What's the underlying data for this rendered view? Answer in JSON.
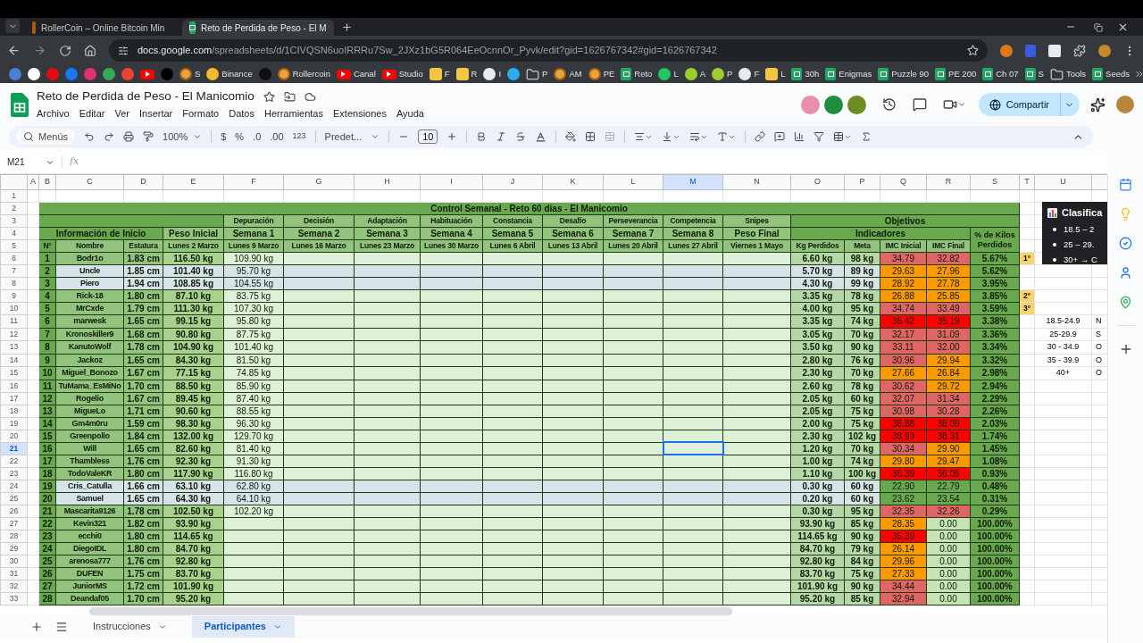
{
  "browser": {
    "tabs": [
      {
        "title": "RollerCoin – Online Bitcoin Min",
        "kind": "coin",
        "selected": false
      },
      {
        "title": "Reto de Perdida de Peso - El M",
        "kind": "sheet",
        "selected": true
      }
    ],
    "url_host": "docs.google.com",
    "url_path": "/spreadsheets/d/1CIVQSN6uoIRRRu7Sw_2JXz1bG5R064EeOcnnOr_Pyvk/edit?gid=1626767342#gid=1626767342",
    "bookmarks": [
      {
        "kind": "site",
        "color": "#4a7fd6"
      },
      {
        "kind": "site",
        "color": "#ffffff"
      },
      {
        "kind": "site",
        "color": "#e50914"
      },
      {
        "kind": "site",
        "color": "#1877f2"
      },
      {
        "kind": "site",
        "color": "#e1306c"
      },
      {
        "kind": "site",
        "color": "#34a853"
      },
      {
        "kind": "site",
        "color": "#ea4335"
      },
      {
        "kind": "video"
      },
      {
        "kind": "site",
        "color": "#000000"
      },
      {
        "kind": "coin",
        "label": "S"
      },
      {
        "kind": "site",
        "color": "#f3ba2f",
        "label": "Binance"
      },
      {
        "kind": "site",
        "color": "#111111"
      },
      {
        "kind": "coin",
        "label": "Rollercoin"
      },
      {
        "kind": "video",
        "label": "Canal"
      },
      {
        "kind": "video",
        "label": "Studio"
      },
      {
        "kind": "face",
        "label": "F"
      },
      {
        "kind": "face",
        "label": "R"
      },
      {
        "kind": "site",
        "color": "#e8eaed",
        "label": "I"
      },
      {
        "kind": "site",
        "color": "#2aabee"
      },
      {
        "kind": "folder",
        "label": "P"
      },
      {
        "kind": "coin",
        "label": "AM"
      },
      {
        "kind": "coin",
        "label": "PE"
      },
      {
        "kind": "sheet",
        "label": "Reto"
      },
      {
        "kind": "site",
        "color": "#22c55e",
        "label": "L"
      },
      {
        "kind": "site",
        "color": "#9acd32",
        "label": "A"
      },
      {
        "kind": "site",
        "color": "#9acd32",
        "label": "P"
      },
      {
        "kind": "site",
        "color": "#e8eaed",
        "label": "F"
      },
      {
        "kind": "face",
        "label": "L"
      },
      {
        "kind": "sheet",
        "label": "30h"
      },
      {
        "kind": "sheet",
        "label": "Enigmas"
      },
      {
        "kind": "sheet",
        "label": "Puzzle 90"
      },
      {
        "kind": "sheet",
        "label": "PE 200"
      },
      {
        "kind": "sheet",
        "label": "Ch 07"
      },
      {
        "kind": "sheet",
        "label": "S"
      },
      {
        "kind": "folder",
        "label": "Tools"
      },
      {
        "kind": "sheet",
        "label": "Seeds"
      }
    ]
  },
  "doc": {
    "title": "Reto de Perdida de Peso - El Manicomio",
    "menu": [
      "Archivo",
      "Editar",
      "Ver",
      "Insertar",
      "Formato",
      "Datos",
      "Herramientas",
      "Extensiones",
      "Ayuda"
    ],
    "share": "Compartir",
    "collaborators": [
      {
        "color": "#e88fb0"
      },
      {
        "color": "#1e8e3e"
      },
      {
        "color": "#6b8e23"
      }
    ]
  },
  "toolbar": {
    "search": "Menús",
    "zoom": "100%",
    "currency": "$",
    "percent": "%",
    "dec_less": ".0",
    "dec_more": ".00",
    "format_more": "123",
    "font": "Predet...",
    "font_size": "10"
  },
  "formula_bar": {
    "cell_ref": "M21",
    "fx": "fx"
  },
  "columns": [
    {
      "label": "A",
      "selected": false
    },
    {
      "label": "B",
      "selected": false
    },
    {
      "label": "C",
      "selected": false
    },
    {
      "label": "D",
      "selected": false
    },
    {
      "label": "E",
      "selected": false
    },
    {
      "label": "F",
      "selected": false
    },
    {
      "label": "G",
      "selected": false
    },
    {
      "label": "H",
      "selected": false
    },
    {
      "label": "I",
      "selected": false
    },
    {
      "label": "J",
      "selected": false
    },
    {
      "label": "K",
      "selected": false
    },
    {
      "label": "L",
      "selected": false
    },
    {
      "label": "M",
      "selected": true
    },
    {
      "label": "N",
      "selected": false
    },
    {
      "label": "O",
      "selected": false
    },
    {
      "label": "P",
      "selected": false
    },
    {
      "label": "Q",
      "selected": false
    },
    {
      "label": "R",
      "selected": false
    },
    {
      "label": "S",
      "selected": false
    },
    {
      "label": "T",
      "selected": false
    },
    {
      "label": "U",
      "selected": false
    }
  ],
  "row_headers": [
    {
      "label": "1",
      "selected": false
    },
    {
      "label": "2",
      "selected": false
    },
    {
      "label": "3",
      "selected": false
    },
    {
      "label": "4",
      "selected": false
    },
    {
      "label": "5",
      "selected": false
    },
    {
      "label": "6",
      "selected": false
    },
    {
      "label": "7",
      "selected": false
    },
    {
      "label": "8",
      "selected": false
    },
    {
      "label": "9",
      "selected": false
    },
    {
      "label": "10",
      "selected": false
    },
    {
      "label": "11",
      "selected": false
    },
    {
      "label": "12",
      "selected": false
    },
    {
      "label": "13",
      "selected": false
    },
    {
      "label": "14",
      "selected": false
    },
    {
      "label": "15",
      "selected": false
    },
    {
      "label": "16",
      "selected": false
    },
    {
      "label": "17",
      "selected": false
    },
    {
      "label": "18",
      "selected": false
    },
    {
      "label": "19",
      "selected": false
    },
    {
      "label": "20",
      "selected": false
    },
    {
      "label": "21",
      "selected": true
    },
    {
      "label": "22",
      "selected": false
    },
    {
      "label": "23",
      "selected": false
    },
    {
      "label": "24",
      "selected": false
    },
    {
      "label": "25",
      "selected": false
    },
    {
      "label": "26",
      "selected": false
    },
    {
      "label": "27",
      "selected": false
    },
    {
      "label": "28",
      "selected": false
    },
    {
      "label": "29",
      "selected": false
    },
    {
      "label": "30",
      "selected": false
    },
    {
      "label": "31",
      "selected": false
    },
    {
      "label": "32",
      "selected": false
    },
    {
      "label": "33",
      "selected": false
    }
  ],
  "sheet": {
    "title": "Control Semanal - Reto 60 días - El Manicomio",
    "phases": [
      "Depuración",
      "Decisión",
      "Adaptación",
      "Habituación",
      "Constancia",
      "Desafío",
      "Perseverancia",
      "Competencia",
      "Snipes"
    ],
    "objectives": "Objetivos",
    "info": "Información de Inicio",
    "initial_weight": "Peso Inicial",
    "weeks": [
      "Semana 1",
      "Semana 2",
      "Semana 3",
      "Semana 4",
      "Semana 5",
      "Semana 6",
      "Semana 7",
      "Semana 8",
      "Peso Final"
    ],
    "indicators": "Indicadores",
    "pct_header": "% de Kilos Perdidos",
    "headers": [
      "N°",
      "Nombre",
      "Estatura",
      "Lunes 2 Marzo",
      "Lunes 9 Marzo",
      "Lunes 16 Marzo",
      "Lunes 23 Marzo",
      "Lunes 30 Marzo",
      "Lunes 6 Abril",
      "Lunes 13 Abril",
      "Lunes 20 Abril",
      "Lunes 27 Abril",
      "Viernes 1 Mayo",
      "Kg Perdidos",
      "Meta",
      "IMC Inicial",
      "IMC Final"
    ],
    "rows": [
      {
        "n": "1",
        "name": "Bodr1o",
        "height": "1.83 cm",
        "initial": "116.50 kg",
        "week1": "109.90 kg",
        "lost": "6.60 kg",
        "goal": "98 kg",
        "imc_initial": {
          "value": "34.79",
          "color": "#e06666"
        },
        "imc_final": {
          "value": "32.82",
          "color": "#e06666"
        },
        "pct": "5.67%",
        "rank": "1°",
        "highlighted": false
      },
      {
        "n": "2",
        "name": "Uncle",
        "height": "1.85 cm",
        "initial": "101.40 kg",
        "week1": "95.70 kg",
        "lost": "5.70 kg",
        "goal": "89 kg",
        "imc_initial": {
          "value": "29.63",
          "color": "#ff9900"
        },
        "imc_final": {
          "value": "27.96",
          "color": "#ff9900"
        },
        "pct": "5.62%",
        "highlighted": true
      },
      {
        "n": "3",
        "name": "Piero",
        "height": "1.94 cm",
        "initial": "108.85 kg",
        "week1": "104.55 kg",
        "lost": "4.30 kg",
        "goal": "99 kg",
        "imc_initial": {
          "value": "28.92",
          "color": "#ff9900"
        },
        "imc_final": {
          "value": "27.78",
          "color": "#ff9900"
        },
        "pct": "3.95%",
        "highlighted": true
      },
      {
        "n": "4",
        "name": "Rick-18",
        "height": "1.80 cm",
        "initial": "87.10 kg",
        "week1": "83.75 kg",
        "lost": "3.35 kg",
        "goal": "78 kg",
        "imc_initial": {
          "value": "26.88",
          "color": "#ff9900"
        },
        "imc_final": {
          "value": "25.85",
          "color": "#ff9900"
        },
        "pct": "3.85%",
        "rank": "2°",
        "highlighted": false
      },
      {
        "n": "5",
        "name": "MrCxde",
        "height": "1.79 cm",
        "initial": "111.30 kg",
        "week1": "107.30 kg",
        "lost": "4.00 kg",
        "goal": "95 kg",
        "imc_initial": {
          "value": "34.74",
          "color": "#e06666"
        },
        "imc_final": {
          "value": "33.49",
          "color": "#e06666"
        },
        "pct": "3.59%",
        "rank": "3°",
        "highlighted": false
      },
      {
        "n": "6",
        "name": "marwesk",
        "height": "1.65 cm",
        "initial": "99.15 kg",
        "week1": "95.80 kg",
        "lost": "3.35 kg",
        "goal": "74 kg",
        "imc_initial": {
          "value": "36.42",
          "color": "#ff0000"
        },
        "imc_final": {
          "value": "35.19",
          "color": "#ff0000"
        },
        "pct": "3.38%",
        "highlighted": false
      },
      {
        "n": "7",
        "name": "Kronoskiller9",
        "height": "1.68 cm",
        "initial": "90.80 kg",
        "week1": "87.75 kg",
        "lost": "3.05 kg",
        "goal": "70 kg",
        "imc_initial": {
          "value": "32.17",
          "color": "#e06666"
        },
        "imc_final": {
          "value": "31.09",
          "color": "#e06666"
        },
        "pct": "3.36%",
        "highlighted": false
      },
      {
        "n": "8",
        "name": "KanutoWolf",
        "height": "1.78 cm",
        "initial": "104.90 kg",
        "week1": "101.40 kg",
        "lost": "3.50 kg",
        "goal": "90 kg",
        "imc_initial": {
          "value": "33.11",
          "color": "#e06666"
        },
        "imc_final": {
          "value": "32.00",
          "color": "#e06666"
        },
        "pct": "3.34%",
        "highlighted": false
      },
      {
        "n": "9",
        "name": "Jackoz",
        "height": "1.65 cm",
        "initial": "84.30 kg",
        "week1": "81.50 kg",
        "lost": "2.80 kg",
        "goal": "76 kg",
        "imc_initial": {
          "value": "30.96",
          "color": "#e06666"
        },
        "imc_final": {
          "value": "29.94",
          "color": "#ff9900"
        },
        "pct": "3.32%",
        "highlighted": false
      },
      {
        "n": "10",
        "name": "Miguel_Bonozo",
        "height": "1.67 cm",
        "initial": "77.15 kg",
        "week1": "74.85 kg",
        "lost": "2.30 kg",
        "goal": "70 kg",
        "imc_initial": {
          "value": "27.66",
          "color": "#ff9900"
        },
        "imc_final": {
          "value": "26.84",
          "color": "#ff9900"
        },
        "pct": "2.98%",
        "highlighted": false
      },
      {
        "n": "11",
        "name": "TuMama_EsMiNo",
        "height": "1.70 cm",
        "initial": "88.50 kg",
        "week1": "85.90 kg",
        "lost": "2.60 kg",
        "goal": "78 kg",
        "imc_initial": {
          "value": "30.62",
          "color": "#e06666"
        },
        "imc_final": {
          "value": "29.72",
          "color": "#ff9900"
        },
        "pct": "2.94%",
        "highlighted": false
      },
      {
        "n": "12",
        "name": "Rogelio",
        "height": "1.67 cm",
        "initial": "89.45 kg",
        "week1": "87.40 kg",
        "lost": "2.05 kg",
        "goal": "60 kg",
        "imc_initial": {
          "value": "32.07",
          "color": "#e06666"
        },
        "imc_final": {
          "value": "31.34",
          "color": "#e06666"
        },
        "pct": "2.29%",
        "highlighted": false
      },
      {
        "n": "13",
        "name": "MigueLo",
        "height": "1.71 cm",
        "initial": "90.60 kg",
        "week1": "88.55 kg",
        "lost": "2.05 kg",
        "goal": "75 kg",
        "imc_initial": {
          "value": "30.98",
          "color": "#e06666"
        },
        "imc_final": {
          "value": "30.28",
          "color": "#e06666"
        },
        "pct": "2.26%",
        "highlighted": false
      },
      {
        "n": "14",
        "name": "Gm4m0ru",
        "height": "1.59 cm",
        "initial": "98.30 kg",
        "week1": "96.30 kg",
        "lost": "2.00 kg",
        "goal": "75 kg",
        "imc_initial": {
          "value": "38.88",
          "color": "#ff0000"
        },
        "imc_final": {
          "value": "38.09",
          "color": "#ff0000"
        },
        "pct": "2.03%",
        "highlighted": false
      },
      {
        "n": "15",
        "name": "Greenpollo",
        "height": "1.84 cm",
        "initial": "132.00 kg",
        "week1": "129.70 kg",
        "lost": "2.30 kg",
        "goal": "102 kg",
        "imc_initial": {
          "value": "38.99",
          "color": "#ff0000"
        },
        "imc_final": {
          "value": "38.31",
          "color": "#ff0000"
        },
        "pct": "1.74%",
        "highlighted": false
      },
      {
        "n": "16",
        "name": "Will",
        "height": "1.65 cm",
        "initial": "82.60 kg",
        "week1": "81.40 kg",
        "lost": "1.20 kg",
        "goal": "70 kg",
        "imc_initial": {
          "value": "30.34",
          "color": "#e06666"
        },
        "imc_final": {
          "value": "29.90",
          "color": "#ff9900"
        },
        "pct": "1.45%",
        "highlighted": false
      },
      {
        "n": "17",
        "name": "Thambless",
        "height": "1.76 cm",
        "initial": "92.30 kg",
        "week1": "91.30 kg",
        "lost": "1.00 kg",
        "goal": "74 kg",
        "imc_initial": {
          "value": "29.80",
          "color": "#ff9900"
        },
        "imc_final": {
          "value": "29.47",
          "color": "#ff9900"
        },
        "pct": "1.08%",
        "highlighted": false
      },
      {
        "n": "18",
        "name": "TodoValeKR",
        "height": "1.80 cm",
        "initial": "117.90 kg",
        "week1": "116.80 kg",
        "lost": "1.10 kg",
        "goal": "100 kg",
        "imc_initial": {
          "value": "36.39",
          "color": "#ff0000"
        },
        "imc_final": {
          "value": "36.05",
          "color": "#ff0000"
        },
        "pct": "0.93%",
        "highlighted": false
      },
      {
        "n": "19",
        "name": "Cris_Catulla",
        "height": "1.66 cm",
        "initial": "63.10 kg",
        "week1": "62.80 kg",
        "lost": "0.30 kg",
        "goal": "60 kg",
        "imc_initial": {
          "value": "22.90",
          "color": "#6aa84f"
        },
        "imc_final": {
          "value": "22.79",
          "color": "#6aa84f"
        },
        "pct": "0.48%",
        "highlighted": true
      },
      {
        "n": "20",
        "name": "Samuel",
        "height": "1.65 cm",
        "initial": "64.30 kg",
        "week1": "64.10 kg",
        "lost": "0.20 kg",
        "goal": "60 kg",
        "imc_initial": {
          "value": "23.62",
          "color": "#6aa84f"
        },
        "imc_final": {
          "value": "23.54",
          "color": "#6aa84f"
        },
        "pct": "0.31%",
        "highlighted": true
      },
      {
        "n": "21",
        "name": "Mascarita9126",
        "height": "1.78 cm",
        "initial": "102.50 kg",
        "week1": "102.20 kg",
        "lost": "0.30 kg",
        "goal": "95 kg",
        "imc_initial": {
          "value": "32.35",
          "color": "#e06666"
        },
        "imc_final": {
          "value": "32.26",
          "color": "#e06666"
        },
        "pct": "0.29%",
        "highlighted": false
      },
      {
        "n": "22",
        "name": "Kevin321",
        "height": "1.82 cm",
        "initial": "93.90 kg",
        "lost": "93.90 kg",
        "goal": "85 kg",
        "imc_initial": {
          "value": "28.35",
          "color": "#ff9900"
        },
        "imc_final": {
          "value": "0.00",
          "color": "#c5e3b5"
        },
        "pct": "100.00%",
        "highlighted": false
      },
      {
        "n": "23",
        "name": "ecchi0",
        "height": "1.80 cm",
        "initial": "114.65 kg",
        "lost": "114.65 kg",
        "goal": "90 kg",
        "imc_initial": {
          "value": "35.39",
          "color": "#ff0000"
        },
        "imc_final": {
          "value": "0.00",
          "color": "#c5e3b5"
        },
        "pct": "100.00%",
        "highlighted": false
      },
      {
        "n": "24",
        "name": "DiegoIDL",
        "height": "1.80 cm",
        "initial": "84.70 kg",
        "lost": "84.70 kg",
        "goal": "79 kg",
        "imc_initial": {
          "value": "26.14",
          "color": "#ff9900"
        },
        "imc_final": {
          "value": "0.00",
          "color": "#c5e3b5"
        },
        "pct": "100.00%",
        "highlighted": false
      },
      {
        "n": "25",
        "name": "arenosa777",
        "height": "1.76 cm",
        "initial": "92.80 kg",
        "lost": "92.80 kg",
        "goal": "84 kg",
        "imc_initial": {
          "value": "29.96",
          "color": "#ff9900"
        },
        "imc_final": {
          "value": "0.00",
          "color": "#c5e3b5"
        },
        "pct": "100.00%",
        "highlighted": false
      },
      {
        "n": "26",
        "name": "DUFEN",
        "height": "1.75 cm",
        "initial": "83.70 kg",
        "lost": "83.70 kg",
        "goal": "75 kg",
        "imc_initial": {
          "value": "27.33",
          "color": "#ff9900"
        },
        "imc_final": {
          "value": "0.00",
          "color": "#c5e3b5"
        },
        "pct": "100.00%",
        "highlighted": false
      },
      {
        "n": "27",
        "name": "JuniorMS",
        "height": "1.72 cm",
        "initial": "101.90 kg",
        "lost": "101.90 kg",
        "goal": "90 kg",
        "imc_initial": {
          "value": "34.44",
          "color": "#e06666"
        },
        "imc_final": {
          "value": "0.00",
          "color": "#c5e3b5"
        },
        "pct": "100.00%",
        "highlighted": false
      },
      {
        "n": "28",
        "name": "Deandaf05",
        "height": "1.70 cm",
        "initial": "95.20 kg",
        "lost": "95.20 kg",
        "goal": "85 kg",
        "imc_initial": {
          "value": "32.94",
          "color": "#e06666"
        },
        "imc_final": {
          "value": "0.00",
          "color": "#c5e3b5"
        },
        "pct": "100.00%",
        "highlighted": false
      }
    ]
  },
  "legend": {
    "title": "Clasifica",
    "items": [
      "18.5 – 2",
      "25 – 29.",
      "30+ → C"
    ]
  },
  "bmi_ranges": [
    {
      "range": "18.5-24.9",
      "label": "N"
    },
    {
      "range": "25-29.9",
      "label": "S"
    },
    {
      "range": "30 - 34.9",
      "label": "O"
    },
    {
      "range": "35 - 39.9",
      "label": "O"
    },
    {
      "range": "40+",
      "label": "O"
    }
  ],
  "sheet_tabs": [
    {
      "label": "Instrucciones",
      "selected": false
    },
    {
      "label": "Participantes",
      "selected": true
    }
  ]
}
